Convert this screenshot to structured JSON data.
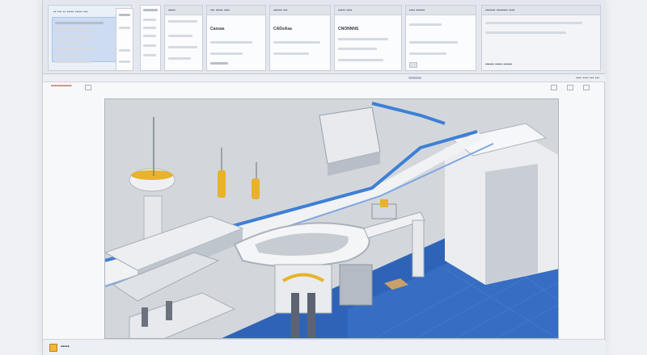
{
  "app": {
    "top_left_label": "▪▪ ▪▪▪ ▪▪ ▪▪▪▪▪ ▪▪▪▪▪ ▪▪▪",
    "panel_headers": [
      "▪▪▪▪▪",
      "▪▪▪ ▪▪▪▪▪ ▪▪▪▪",
      "▪▪▪▪▪▪ ▪▪▪",
      "▪▪▪▪▪ ▪▪▪▪",
      "▪▪▪▪ ▪▪▪▪▪▪",
      "▪▪▪▪▪▪▪ ▪▪▪▪▪▪▪▪ ▪▪▪▪"
    ],
    "panel_values": [
      "Caxsas",
      "CADsAsa",
      "CNONNNS",
      ""
    ],
    "right_panel_foot": "▪▪▪▪▪▪ ▪▪▪▪▪  ▪▪▪▪▪▪"
  },
  "toolbar": {
    "status_text": "▪▪▪▪  ▪▪▪▪  ▪▪▪  ▪▪▪"
  },
  "document": {
    "title": "▪▪▪▪▪▪▪▪▪▪▪▪"
  },
  "status_bar": {
    "text": "▪▪▪▪▪"
  },
  "colors": {
    "accent_blue": "#3e7fd6",
    "floor_blue": "#2f63b8",
    "accent_yellow": "#e8b229",
    "window_bg": "#f7f8fa"
  },
  "icons": [
    "list-icon",
    "status-warning-icon",
    "close-icon",
    "minimize-icon"
  ]
}
